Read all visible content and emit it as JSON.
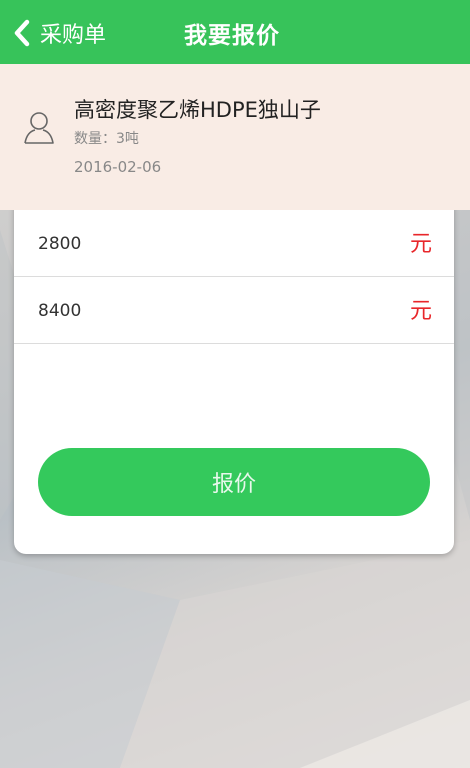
{
  "header": {
    "back_label": "采购单",
    "title": "我要报价"
  },
  "product": {
    "name": "高密度聚乙烯HDPE独山子",
    "quantity": "数量：3吨",
    "date": "2016-02-06"
  },
  "quote_rows": [
    {
      "value": "2800",
      "unit": "元"
    },
    {
      "value": "8400",
      "unit": "元"
    }
  ],
  "submit_label": "报价",
  "colors": {
    "accent": "#37c35a",
    "unit_red": "#e8262a",
    "info_bg": "#f9ece5"
  }
}
